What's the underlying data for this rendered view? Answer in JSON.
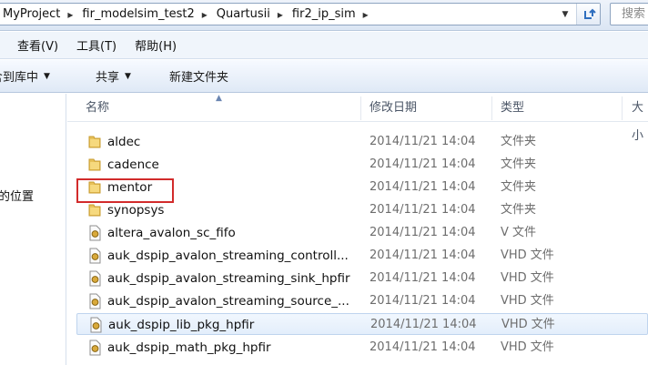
{
  "address": {
    "crumbs": [
      "MyProject",
      "fir_modelsim_test2",
      "Quartusii",
      "fir2_ip_sim"
    ],
    "search_placeholder": "搜索"
  },
  "menu": {
    "items": [
      "查看(V)",
      "工具(T)",
      "帮助(H)"
    ]
  },
  "toolbar": {
    "include_label": "含到库中",
    "share_label": "共享",
    "new_folder_label": "新建文件夹"
  },
  "nav": {
    "partial_label": "的位置"
  },
  "columns": {
    "name": "名称",
    "modified": "修改日期",
    "type": "类型",
    "size": "大小"
  },
  "files": [
    {
      "name": "aldec",
      "date": "2014/11/21 14:04",
      "type": "文件夹",
      "icon": "folder-icon"
    },
    {
      "name": "cadence",
      "date": "2014/11/21 14:04",
      "type": "文件夹",
      "icon": "folder-icon"
    },
    {
      "name": "mentor",
      "date": "2014/11/21 14:04",
      "type": "文件夹",
      "icon": "folder-icon"
    },
    {
      "name": "synopsys",
      "date": "2014/11/21 14:04",
      "type": "文件夹",
      "icon": "folder-icon"
    },
    {
      "name": "altera_avalon_sc_fifo",
      "date": "2014/11/21 14:04",
      "type": "V 文件",
      "icon": "file-icon"
    },
    {
      "name": "auk_dspip_avalon_streaming_controll...",
      "date": "2014/11/21 14:04",
      "type": "VHD 文件",
      "icon": "file-icon"
    },
    {
      "name": "auk_dspip_avalon_streaming_sink_hpfir",
      "date": "2014/11/21 14:04",
      "type": "VHD 文件",
      "icon": "file-icon"
    },
    {
      "name": "auk_dspip_avalon_streaming_source_...",
      "date": "2014/11/21 14:04",
      "type": "VHD 文件",
      "icon": "file-icon"
    },
    {
      "name": "auk_dspip_lib_pkg_hpfir",
      "date": "2014/11/21 14:04",
      "type": "VHD 文件",
      "icon": "file-icon"
    },
    {
      "name": "auk_dspip_math_pkg_hpfir",
      "date": "2014/11/21 14:04",
      "type": "VHD 文件",
      "icon": "file-icon"
    }
  ],
  "colors": {
    "highlight": "#d22b2b",
    "folder": "#e8c25a",
    "selection": "#e3eefb"
  }
}
